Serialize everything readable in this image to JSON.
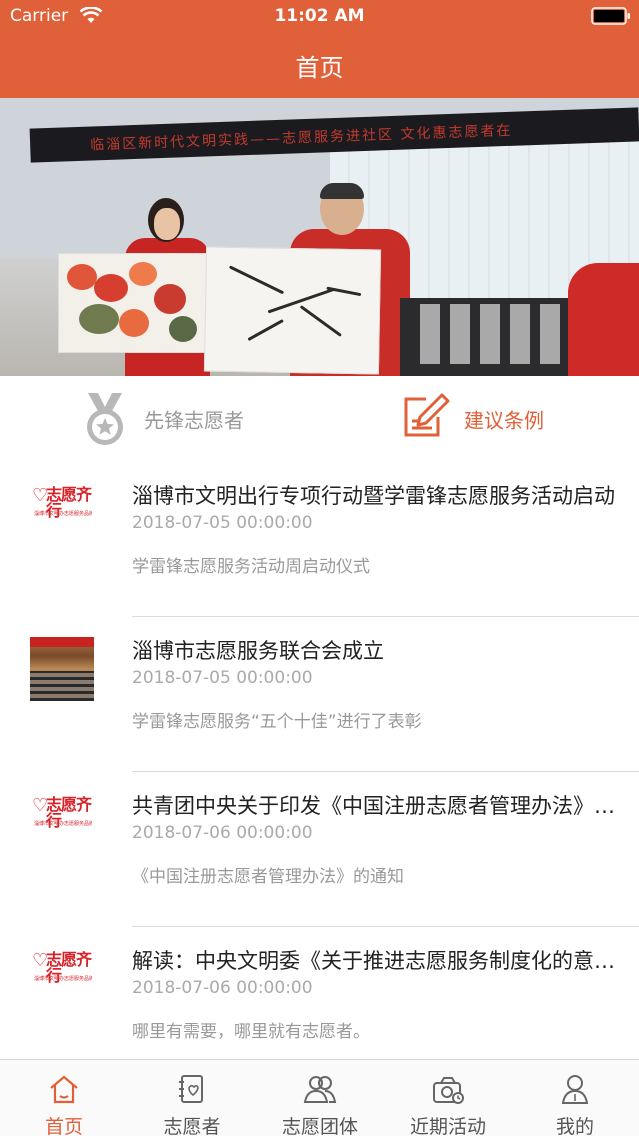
{
  "status_bar": {
    "carrier": "Carrier",
    "time": "11:02 AM"
  },
  "nav": {
    "title": "首页"
  },
  "banner": {
    "strip_text": "临淄区新时代文明实践——志愿服务进社区 文化惠志愿者在"
  },
  "categories": [
    {
      "label": "先锋志愿者",
      "icon": "medal-icon"
    },
    {
      "label": "建议条例",
      "icon": "edit-icon"
    }
  ],
  "news": [
    {
      "thumb": "logo",
      "title": "淄博市文明出行专项行动暨学雷锋志愿服务活动启动",
      "date": "2018-07-05 00:00:00",
      "summary": "学雷锋志愿服务活动周启动仪式"
    },
    {
      "thumb": "photo",
      "title": "淄博市志愿服务联合会成立",
      "date": "2018-07-05 00:00:00",
      "summary": "学雷锋志愿服务“五个十佳”进行了表彰"
    },
    {
      "thumb": "logo",
      "title": "共青团中央关于印发《中国注册志愿者管理办法》的通知",
      "date": "2018-07-06 00:00:00",
      "summary": "《中国注册志愿者管理办法》的通知"
    },
    {
      "thumb": "logo",
      "title": "解读：中央文明委《关于推进志愿服务制度化的意见》",
      "date": "2018-07-06 00:00:00",
      "summary": "哪里有需要，哪里就有志愿者。"
    }
  ],
  "logo": {
    "text": "志愿齐行",
    "sub": "淄博市文明办志愿服务品牌"
  },
  "tabs": [
    {
      "label": "首页",
      "icon": "home-icon",
      "active": true
    },
    {
      "label": "志愿者",
      "icon": "volunteer-card-icon",
      "active": false
    },
    {
      "label": "志愿团体",
      "icon": "group-icon",
      "active": false
    },
    {
      "label": "近期活动",
      "icon": "activity-icon",
      "active": false
    },
    {
      "label": "我的",
      "icon": "profile-icon",
      "active": false
    }
  ],
  "colors": {
    "accent": "#e0603a",
    "text_primary": "#222222",
    "text_secondary": "#999999"
  }
}
